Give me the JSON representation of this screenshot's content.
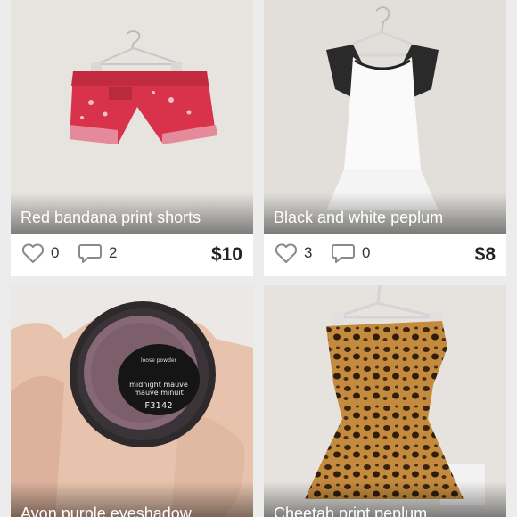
{
  "listings": [
    {
      "title": "Red bandana print shorts",
      "likes": "0",
      "comments": "2",
      "price": "$10"
    },
    {
      "title": "Black and white peplum",
      "likes": "3",
      "comments": "0",
      "price": "$8"
    },
    {
      "title": "Avon purple eyeshadow",
      "likes": "",
      "comments": "",
      "price": "",
      "jar_label": [
        "loose powder",
        "midnight mauve",
        "mauve minuit",
        "F3142"
      ]
    },
    {
      "title": "Cheetah print peplum",
      "likes": "",
      "comments": "",
      "price": ""
    }
  ],
  "icons": {
    "like": "heart-icon",
    "comment": "speech-bubble-icon"
  },
  "colors": {
    "price": "#222222",
    "caption_text": "#ffffff",
    "icon_stroke": "#8a8a8a"
  }
}
